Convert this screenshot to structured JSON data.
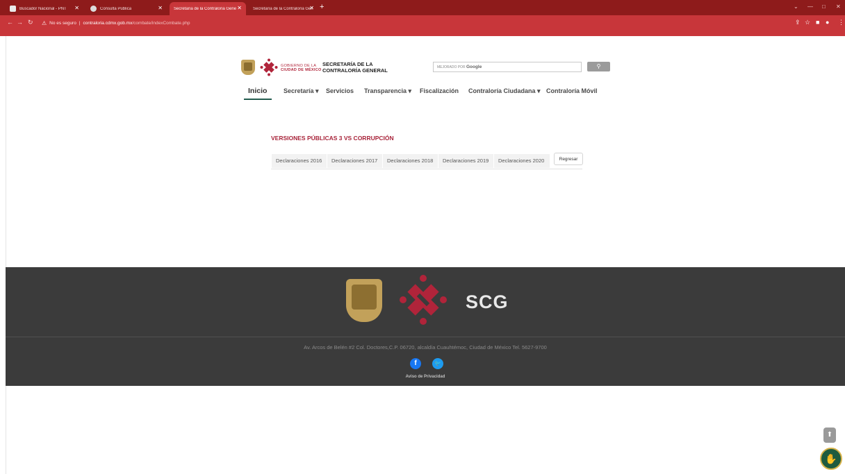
{
  "browser": {
    "tabs": [
      {
        "title": "Buscador Nacional - PNT"
      },
      {
        "title": "Consulta Pública"
      },
      {
        "title": "Secretaría de la Contraloría Gene"
      },
      {
        "title": "Secretaría de la Contraloría Gene"
      }
    ],
    "security": "No es seguro",
    "url_host": "contraloria.cdmx.gob.mx",
    "url_path": "/combate/indexCombate.php"
  },
  "header": {
    "gob_line1": "GOBIERNO DE LA",
    "gob_line2": "CIUDAD DE MÉXICO",
    "sec_line1": "SECRETARÍA DE LA",
    "sec_line2": "CONTRALORÍA GENERAL",
    "search": {
      "powered_by": "MEJORADO POR",
      "brand": "Google"
    },
    "nav": [
      {
        "label": "Inicio"
      },
      {
        "label": "Secretaría"
      },
      {
        "label": "Servicios"
      },
      {
        "label": "Transparencia"
      },
      {
        "label": "Fiscalización"
      },
      {
        "label": "Contraloría Ciudadana"
      },
      {
        "label": "Contraloría Móvil"
      }
    ]
  },
  "main": {
    "title": "VERSIONES PÚBLICAS 3 VS CORRUPCIÓN",
    "tabs": [
      {
        "label": "Declaraciones 2016"
      },
      {
        "label": "Declaraciones 2017"
      },
      {
        "label": "Declaraciones 2018"
      },
      {
        "label": "Declaraciones 2019"
      },
      {
        "label": "Declaraciones 2020"
      }
    ],
    "back_button": "Regresar"
  },
  "footer": {
    "acronym": "SCG",
    "address": "Av. Arcos de Belén #2 Col. Doctores,C.P. 06720, alcaldía Cuauhtémoc, Ciudad de México Tel. 5627-9700",
    "privacy": "Aviso de Privacidad"
  },
  "colors": {
    "brand_red": "#a8243a",
    "chrome_red": "#c8363a",
    "footer_bg": "#3b3b3b",
    "active_nav": "#235b4e"
  }
}
